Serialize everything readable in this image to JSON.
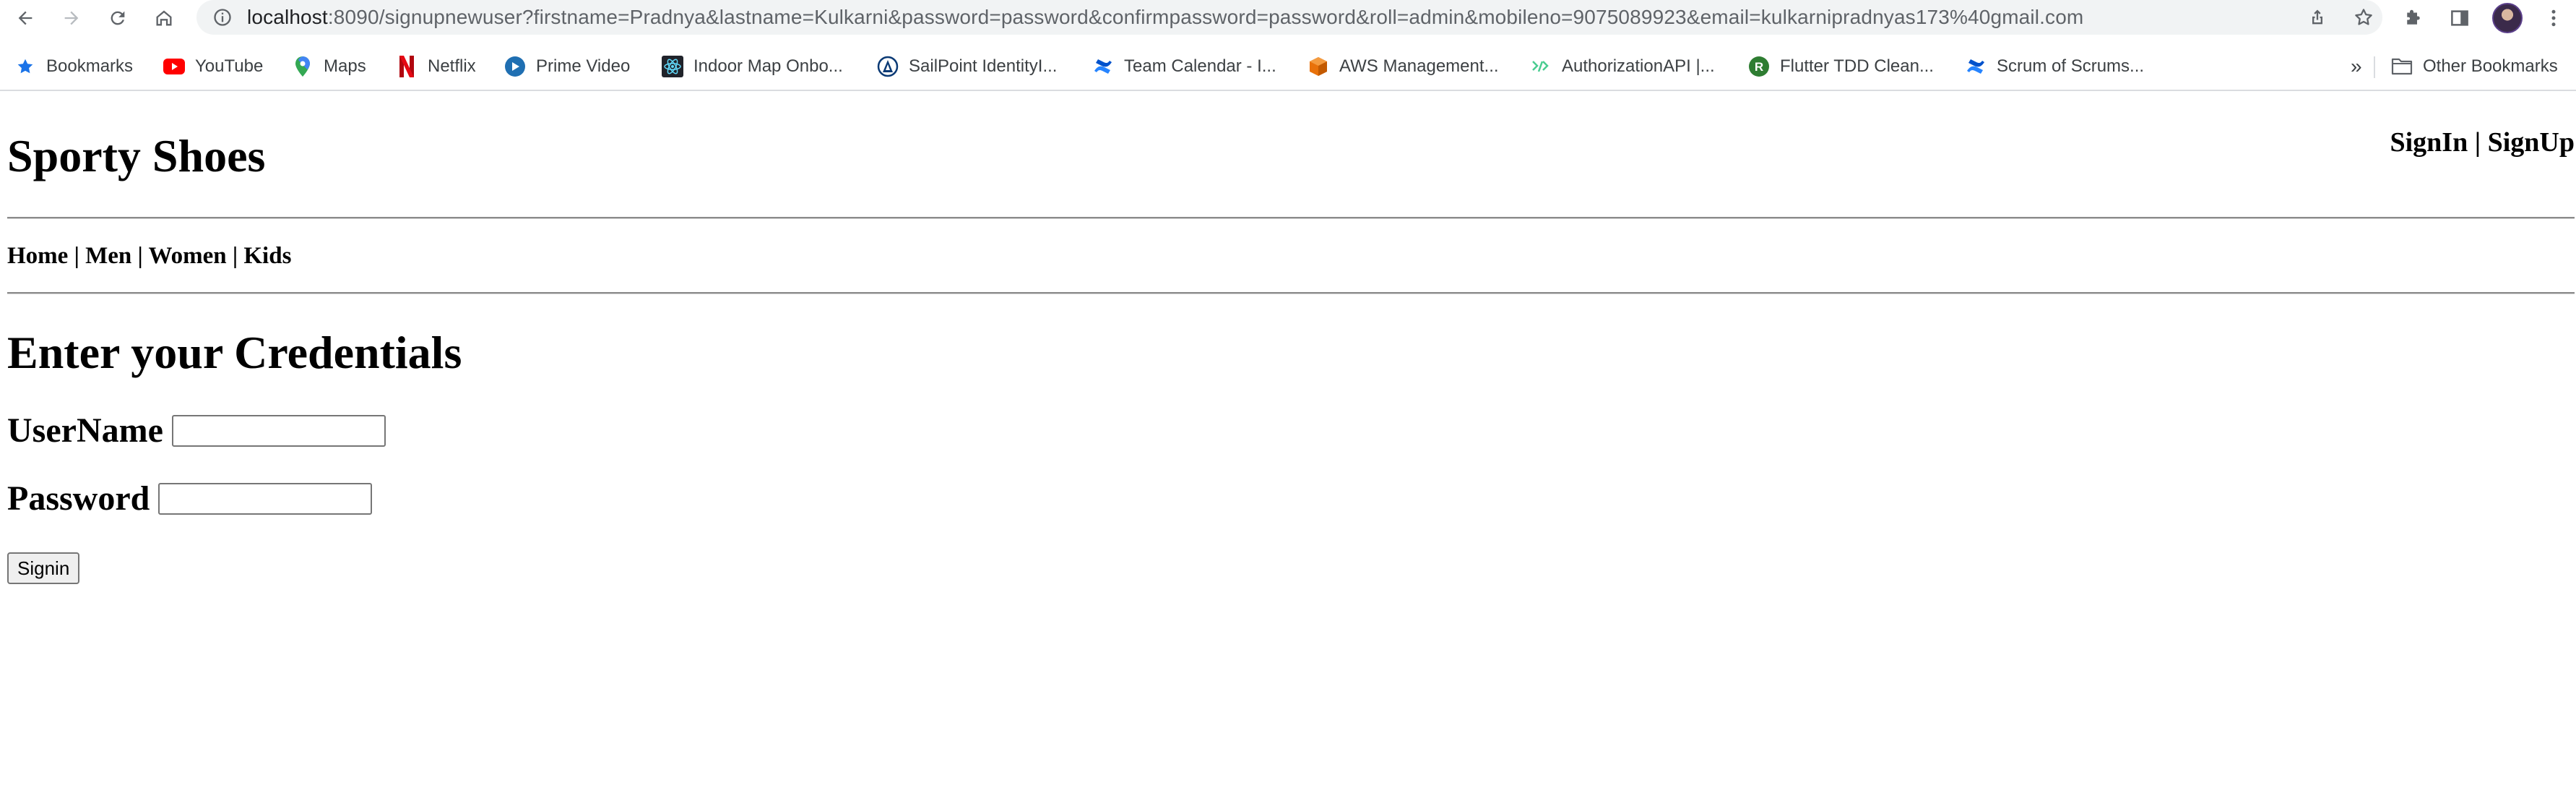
{
  "browser": {
    "url_host": "localhost",
    "url_rest": ":8090/signupnewuser?firstname=Pradnya&lastname=Kulkarni&password=password&confirmpassword=password&roll=admin&mobileno=9075089923&email=kulkarnipradnyas173%40gmail.com",
    "icons": {
      "back": "back-arrow-icon",
      "forward": "forward-arrow-icon",
      "reload": "reload-icon",
      "home": "home-icon",
      "info": "info-icon",
      "share": "share-icon",
      "star": "bookmark-star-icon",
      "extensions": "puzzle-icon",
      "side_panel": "side-panel-icon",
      "menu": "more-vertical-icon"
    }
  },
  "bookmarks": {
    "items": [
      {
        "label": "Bookmarks",
        "icon": "star-icon",
        "color": "#1a73e8"
      },
      {
        "label": "YouTube",
        "icon": "youtube-icon",
        "color": "#ff0000"
      },
      {
        "label": "Maps",
        "icon": "maps-pin-icon",
        "color": "#34a853"
      },
      {
        "label": "Netflix",
        "icon": "netflix-icon",
        "color": "#e50914"
      },
      {
        "label": "Prime Video",
        "icon": "prime-video-icon",
        "color": "#1f6fb2"
      },
      {
        "label": "Indoor Map Onbo...",
        "icon": "react-icon",
        "color": "#20232a"
      },
      {
        "label": "SailPoint IdentityI...",
        "icon": "sailpoint-icon",
        "color": "#0b3a75"
      },
      {
        "label": "Team Calendar - I...",
        "icon": "confluence-icon",
        "color": "#2684ff"
      },
      {
        "label": "AWS Management...",
        "icon": "aws-cube-icon",
        "color": "#e8710a"
      },
      {
        "label": "AuthorizationAPI |...",
        "icon": "swagger-icon",
        "color": "#49cc90"
      },
      {
        "label": "Flutter TDD Clean...",
        "icon": "r-logo-icon",
        "color": "#2e7d32"
      },
      {
        "label": "Scrum of Scrums...",
        "icon": "confluence-icon",
        "color": "#2684ff"
      }
    ],
    "overflow": "»",
    "other_label": "Other Bookmarks"
  },
  "site": {
    "brand": "Sporty Shoes",
    "auth": {
      "signin": "SignIn",
      "separator": "|",
      "signup": "SignUp"
    },
    "menu": [
      {
        "label": "Home"
      },
      {
        "label": "Men"
      },
      {
        "label": "Women"
      },
      {
        "label": "Kids"
      }
    ],
    "menu_separator": "|"
  },
  "form": {
    "title": "Enter your Credentials",
    "username_label": "UserName",
    "username_value": "",
    "password_label": "Password",
    "password_value": "",
    "submit_label": "Signin"
  }
}
